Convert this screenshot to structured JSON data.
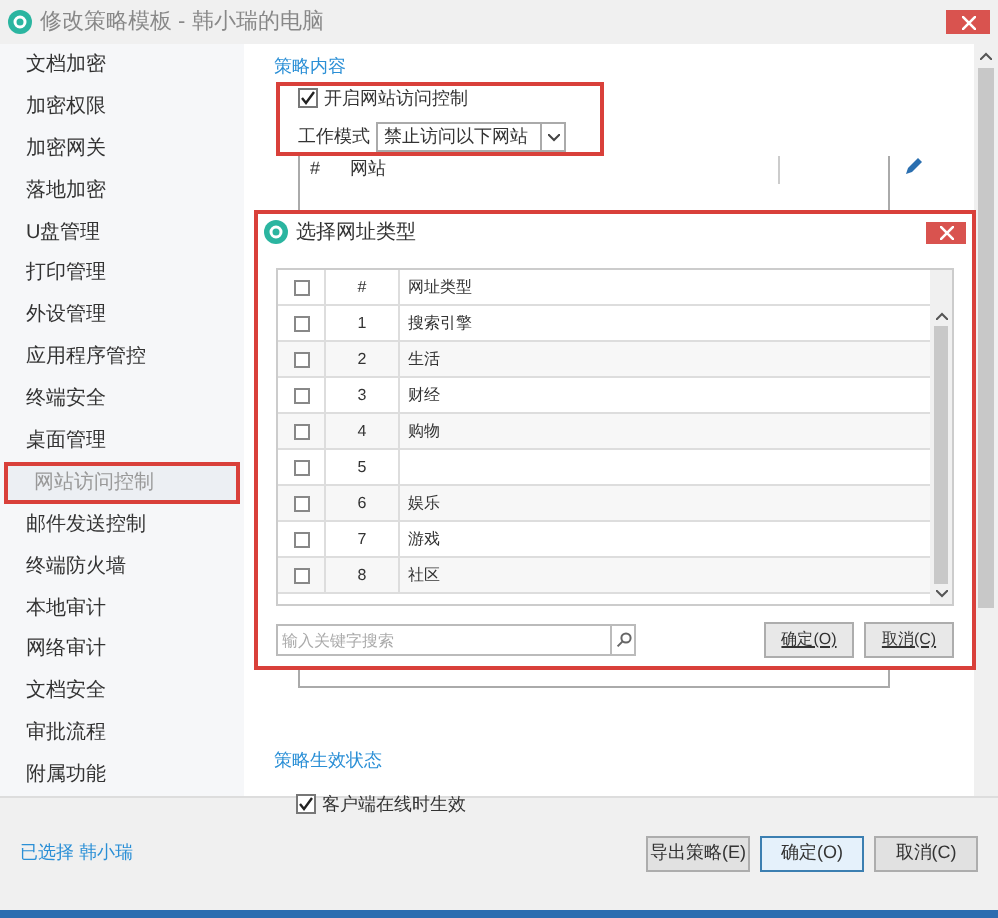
{
  "window": {
    "title": "修改策略模板 - 韩小瑞的电脑"
  },
  "sidebar": {
    "items": [
      {
        "label": "文档加密",
        "selected": false
      },
      {
        "label": "加密权限",
        "selected": false
      },
      {
        "label": "加密网关",
        "selected": false
      },
      {
        "label": "落地加密",
        "selected": false
      },
      {
        "label": "U盘管理",
        "selected": false
      },
      {
        "label": "打印管理",
        "selected": false
      },
      {
        "label": "外设管理",
        "selected": false
      },
      {
        "label": "应用程序管控",
        "selected": false
      },
      {
        "label": "终端安全",
        "selected": false
      },
      {
        "label": "桌面管理",
        "selected": false
      },
      {
        "label": "网站访问控制",
        "selected": true
      },
      {
        "label": "邮件发送控制",
        "selected": false
      },
      {
        "label": "终端防火墙",
        "selected": false
      },
      {
        "label": "本地审计",
        "selected": false
      },
      {
        "label": "网络审计",
        "selected": false
      },
      {
        "label": "文档安全",
        "selected": false
      },
      {
        "label": "审批流程",
        "selected": false
      },
      {
        "label": "附属功能",
        "selected": false
      }
    ]
  },
  "content": {
    "section_title": "策略内容",
    "enable_option": {
      "label": "开启网站访问控制",
      "checked": true
    },
    "work_mode": {
      "label": "工作模式",
      "value": "禁止访问以下网站"
    },
    "site_table": {
      "columns": [
        "#",
        "网站"
      ]
    },
    "status_title": "策略生效状态",
    "status_option": {
      "label": "客户端在线时生效",
      "checked": true
    }
  },
  "footer": {
    "selected_text": "已选择 韩小瑞",
    "buttons": [
      "导出策略(E)",
      "确定(O)",
      "取消(C)"
    ]
  },
  "dialog": {
    "title": "选择网址类型",
    "select_all_checked": false,
    "columns": [
      "#",
      "网址类型"
    ],
    "rows": [
      {
        "number": "1",
        "type": "搜索引擎",
        "checked": false
      },
      {
        "number": "2",
        "type": "生活",
        "checked": false
      },
      {
        "number": "3",
        "type": "财经",
        "checked": false
      },
      {
        "number": "4",
        "type": "购物",
        "checked": false
      },
      {
        "number": "5",
        "checked": false
      },
      {
        "number": "6",
        "type": "娱乐",
        "checked": false
      },
      {
        "number": "7",
        "type": "游戏",
        "checked": false
      },
      {
        "number": "8",
        "type": "社区",
        "checked": false
      }
    ],
    "search": {
      "placeholder": "输入关键字搜索"
    },
    "buttons": [
      "确定(O)",
      "取消(C)"
    ]
  }
}
